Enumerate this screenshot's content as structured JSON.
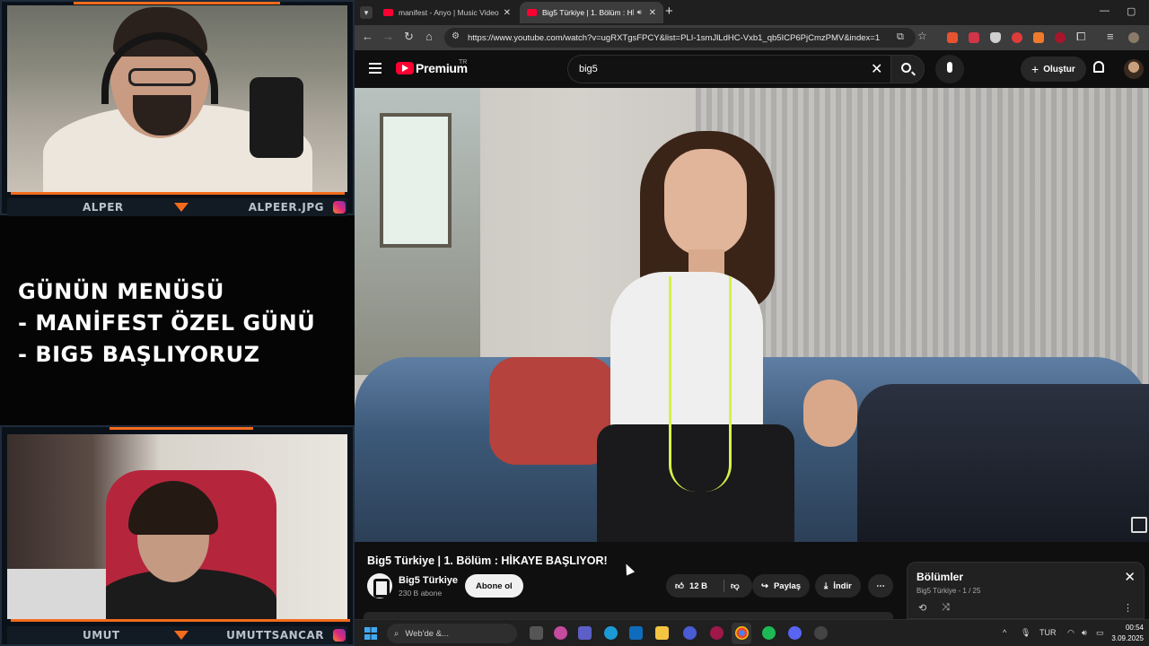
{
  "overlay": {
    "top_cam": {
      "name": "ALPER",
      "handle": "ALPEER.JPG"
    },
    "bottom_cam": {
      "name": "UMUT",
      "handle": "UMUTTSANCAR"
    },
    "menu_lines": [
      "GÜNÜN MENÜSÜ",
      "- MANİFEST ÖZEL GÜNÜ",
      "- BIG5 BAŞLIYORUZ"
    ],
    "accent": "#f36b1c"
  },
  "browser": {
    "tabs": [
      {
        "title": "manifest - Anyo | Music Video",
        "active": false
      },
      {
        "title": "Big5 Türkiye | 1. Bölüm : Hİ",
        "active": true
      }
    ],
    "url": "https://www.youtube.com/watch?v=ugRXTgsFPCY&list=PLI-1smJlLdHC-Vxb1_qb5ICP6PjCmzPMV&index=1",
    "icons": [
      "back-icon",
      "forward-icon",
      "reload-icon",
      "home-icon",
      "site-settings-icon",
      "install-icon",
      "star-icon",
      "extensions-icon",
      "menu-icon"
    ]
  },
  "youtube": {
    "brand": "Premium",
    "country": "TR",
    "search_query": "big5",
    "create_label": "Oluştur",
    "video_title": "Big5 Türkiye | 1. Bölüm : HİKAYE BAŞLIYOR!",
    "channel": {
      "name": "Big5 Türkiye",
      "subscribers": "230 B abone"
    },
    "subscribe_label": "Abone ol",
    "likes": "12 B",
    "share_label": "Paylaş",
    "download_label": "İndir",
    "playlist": {
      "title": "Bölümler",
      "subtitle": "Big5 Türkiye - 1 / 25"
    }
  },
  "taskbar": {
    "search_placeholder": "Web'de &...",
    "lang": "TUR",
    "time": "00:54",
    "date": "3.09.2025"
  }
}
